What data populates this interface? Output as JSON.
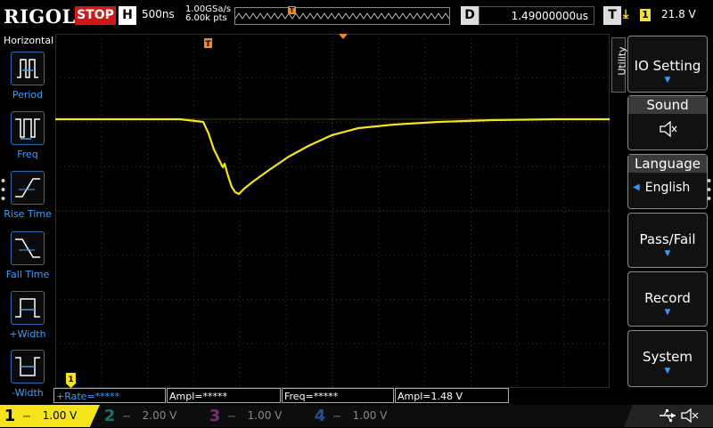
{
  "top": {
    "logo": "RIGOL",
    "run_state": "STOP",
    "horizontal_badge": "H",
    "timebase": "500ns",
    "sample_rate": "1.00GSa/s",
    "memory_depth": "6.00k pts",
    "delay_badge": "D",
    "delay_value": "1.49000000us",
    "trigger_badge": "T",
    "trigger_source": "1",
    "trigger_level": "21.8 V"
  },
  "left_panel": {
    "title": "Horizontal",
    "items": [
      {
        "label": "Period"
      },
      {
        "label": "Freq"
      },
      {
        "label": "Rise Time"
      },
      {
        "label": "Fall Time"
      },
      {
        "label": "+Width"
      },
      {
        "label": "-Width"
      }
    ]
  },
  "right_menu": {
    "tab": "Utility",
    "items": [
      {
        "label": "IO Setting",
        "value": ""
      },
      {
        "label": "Sound",
        "value": ""
      },
      {
        "label": "Language",
        "value": "English"
      },
      {
        "label": "Pass/Fail",
        "value": ""
      },
      {
        "label": "Record",
        "value": ""
      },
      {
        "label": "System",
        "value": ""
      }
    ]
  },
  "measurements": [
    {
      "text": "+Rate=*****",
      "color": "#3aa0ff"
    },
    {
      "text": "Ampl=*****",
      "color": "#ffffff"
    },
    {
      "text": "Freq=*****",
      "color": "#ffffff"
    },
    {
      "text": "Ampl=1.48 V",
      "color": "#ffffff"
    }
  ],
  "channels": [
    {
      "num": "1",
      "scale": "1.00 V",
      "color": "#f5e41a"
    },
    {
      "num": "2",
      "scale": "2.00 V",
      "color": "#1fb4a5"
    },
    {
      "num": "3",
      "scale": "1.00 V",
      "color": "#c044c0"
    },
    {
      "num": "4",
      "scale": "1.00 V",
      "color": "#3a7fd8"
    }
  ],
  "colors": {
    "ch1": "#f5e41a",
    "trigger_marker": "#f08a24",
    "accent_blue": "#2f9bff",
    "grid": "#3a3a3a"
  },
  "icons": [
    "usb-icon",
    "speaker-mute-icon"
  ]
}
